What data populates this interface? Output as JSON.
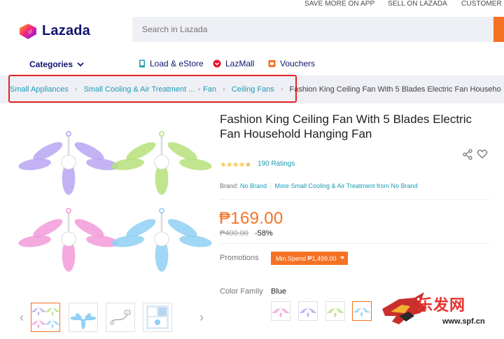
{
  "top_links": [
    "SAVE MORE ON APP",
    "SELL ON LAZADA",
    "CUSTOMER CA"
  ],
  "header": {
    "logo_text": "Lazada",
    "search_placeholder": "Search in Lazada",
    "brand_colors": {
      "accent": "#f57224",
      "navy": "#0f146d",
      "link": "#1a9cb7"
    }
  },
  "nav": {
    "categories_label": "Categories",
    "items": [
      {
        "label": "Load & eStore",
        "icon": "phone-icon"
      },
      {
        "label": "LazMall",
        "icon": "lazmall-icon"
      },
      {
        "label": "Vouchers",
        "icon": "voucher-icon"
      }
    ]
  },
  "breadcrumb": {
    "links": [
      "Small Appliances",
      "Small Cooling & Air Treatment ...",
      "Fan",
      "Ceiling Fans"
    ],
    "current": "Fashion King Ceiling Fan With 5 Blades Electric Fan Househo"
  },
  "product": {
    "title": "Fashion King Ceiling Fan With 5 Blades Electric Fan Household Hanging Fan",
    "rating_stars": 4.5,
    "rating_count": "190 Ratings",
    "brand_label": "Brand:",
    "brand_name": "No Brand",
    "brand_more": "More Small Cooling & Air Treatment from No Brand",
    "price": "₱169.00",
    "original_price": "₱400.00",
    "discount": "-58%",
    "promotions_label": "Promotions",
    "promotion_tag": "Min.Spend ₱1,499.00",
    "color_family_label": "Color Family",
    "color_family_value": "Blue",
    "fan_colors": [
      "#b9a6f2",
      "#b6e07a",
      "#f29bd8",
      "#8fd0f2"
    ]
  },
  "watermark": {
    "text": "乐发网",
    "url": "www.spf.cn"
  }
}
